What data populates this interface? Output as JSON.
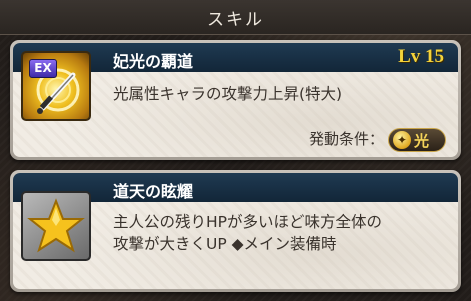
{
  "header": {
    "title": "スキル"
  },
  "skills": [
    {
      "name": "妃光の覇道",
      "level": "Lv 15",
      "badge": "EX",
      "icon": "sword-emblem-icon",
      "description_lines": [
        "光属性キャラの攻撃力上昇(特大)"
      ],
      "condition_label": "発動条件：",
      "condition_value": "光"
    },
    {
      "name": "道天の眩耀",
      "icon": "star-icon",
      "description_lines": [
        "主人公の残りHPが多いほど味方全体の",
        "攻撃が大きくUP ◆メイン装備時"
      ]
    }
  ]
}
